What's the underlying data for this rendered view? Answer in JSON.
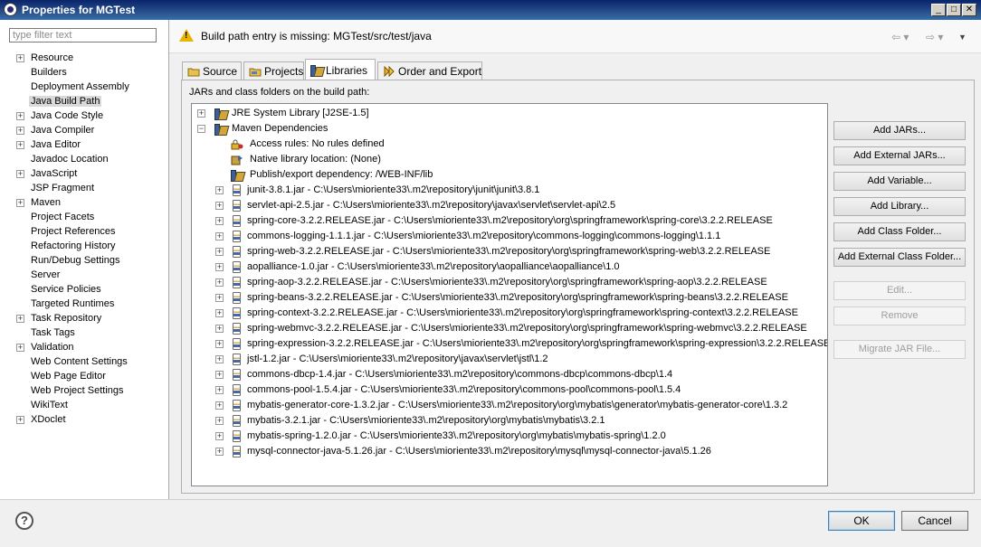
{
  "window": {
    "title": "Properties for MGTest"
  },
  "filter": {
    "placeholder": "type filter text"
  },
  "nav_tree": [
    {
      "label": "Resource",
      "expandable": true
    },
    {
      "label": "Builders",
      "expandable": false
    },
    {
      "label": "Deployment Assembly",
      "expandable": false
    },
    {
      "label": "Java Build Path",
      "expandable": false,
      "selected": true
    },
    {
      "label": "Java Code Style",
      "expandable": true
    },
    {
      "label": "Java Compiler",
      "expandable": true
    },
    {
      "label": "Java Editor",
      "expandable": true
    },
    {
      "label": "Javadoc Location",
      "expandable": false
    },
    {
      "label": "JavaScript",
      "expandable": true
    },
    {
      "label": "JSP Fragment",
      "expandable": false
    },
    {
      "label": "Maven",
      "expandable": true
    },
    {
      "label": "Project Facets",
      "expandable": false
    },
    {
      "label": "Project References",
      "expandable": false
    },
    {
      "label": "Refactoring History",
      "expandable": false
    },
    {
      "label": "Run/Debug Settings",
      "expandable": false
    },
    {
      "label": "Server",
      "expandable": false
    },
    {
      "label": "Service Policies",
      "expandable": false
    },
    {
      "label": "Targeted Runtimes",
      "expandable": false
    },
    {
      "label": "Task Repository",
      "expandable": true
    },
    {
      "label": "Task Tags",
      "expandable": false
    },
    {
      "label": "Validation",
      "expandable": true
    },
    {
      "label": "Web Content Settings",
      "expandable": false
    },
    {
      "label": "Web Page Editor",
      "expandable": false
    },
    {
      "label": "Web Project Settings",
      "expandable": false
    },
    {
      "label": "WikiText",
      "expandable": false
    },
    {
      "label": "XDoclet",
      "expandable": true
    }
  ],
  "message": {
    "text": "Build path entry is missing: MGTest/src/test/java"
  },
  "tabs": [
    {
      "label": "Source"
    },
    {
      "label": "Projects"
    },
    {
      "label": "Libraries",
      "active": true
    },
    {
      "label": "Order and Export"
    }
  ],
  "panel": {
    "label": "JARs and class folders on the build path:"
  },
  "libraries": {
    "jre": "JRE System Library [J2SE-1.5]",
    "maven": "Maven Dependencies",
    "maven_children": [
      "Access rules: No rules defined",
      "Native library location: (None)",
      "Publish/export dependency: /WEB-INF/lib"
    ],
    "jars": [
      "junit-3.8.1.jar - C:\\Users\\mioriente33\\.m2\\repository\\junit\\junit\\3.8.1",
      "servlet-api-2.5.jar - C:\\Users\\mioriente33\\.m2\\repository\\javax\\servlet\\servlet-api\\2.5",
      "spring-core-3.2.2.RELEASE.jar - C:\\Users\\mioriente33\\.m2\\repository\\org\\springframework\\spring-core\\3.2.2.RELEASE",
      "commons-logging-1.1.1.jar - C:\\Users\\mioriente33\\.m2\\repository\\commons-logging\\commons-logging\\1.1.1",
      "spring-web-3.2.2.RELEASE.jar - C:\\Users\\mioriente33\\.m2\\repository\\org\\springframework\\spring-web\\3.2.2.RELEASE",
      "aopalliance-1.0.jar - C:\\Users\\mioriente33\\.m2\\repository\\aopalliance\\aopalliance\\1.0",
      "spring-aop-3.2.2.RELEASE.jar - C:\\Users\\mioriente33\\.m2\\repository\\org\\springframework\\spring-aop\\3.2.2.RELEASE",
      "spring-beans-3.2.2.RELEASE.jar - C:\\Users\\mioriente33\\.m2\\repository\\org\\springframework\\spring-beans\\3.2.2.RELEASE",
      "spring-context-3.2.2.RELEASE.jar - C:\\Users\\mioriente33\\.m2\\repository\\org\\springframework\\spring-context\\3.2.2.RELEASE",
      "spring-webmvc-3.2.2.RELEASE.jar - C:\\Users\\mioriente33\\.m2\\repository\\org\\springframework\\spring-webmvc\\3.2.2.RELEASE",
      "spring-expression-3.2.2.RELEASE.jar - C:\\Users\\mioriente33\\.m2\\repository\\org\\springframework\\spring-expression\\3.2.2.RELEASE",
      "jstl-1.2.jar - C:\\Users\\mioriente33\\.m2\\repository\\javax\\servlet\\jstl\\1.2",
      "commons-dbcp-1.4.jar - C:\\Users\\mioriente33\\.m2\\repository\\commons-dbcp\\commons-dbcp\\1.4",
      "commons-pool-1.5.4.jar - C:\\Users\\mioriente33\\.m2\\repository\\commons-pool\\commons-pool\\1.5.4",
      "mybatis-generator-core-1.3.2.jar - C:\\Users\\mioriente33\\.m2\\repository\\org\\mybatis\\generator\\mybatis-generator-core\\1.3.2",
      "mybatis-3.2.1.jar - C:\\Users\\mioriente33\\.m2\\repository\\org\\mybatis\\mybatis\\3.2.1",
      "mybatis-spring-1.2.0.jar - C:\\Users\\mioriente33\\.m2\\repository\\org\\mybatis\\mybatis-spring\\1.2.0",
      "mysql-connector-java-5.1.26.jar - C:\\Users\\mioriente33\\.m2\\repository\\mysql\\mysql-connector-java\\5.1.26"
    ]
  },
  "buttons": {
    "add_jars": "Add JARs...",
    "add_external_jars": "Add External JARs...",
    "add_variable": "Add Variable...",
    "add_library": "Add Library...",
    "add_class_folder": "Add Class Folder...",
    "add_external_class_folder": "Add External Class Folder...",
    "edit": "Edit...",
    "remove": "Remove",
    "migrate_jar": "Migrate JAR File..."
  },
  "dialog": {
    "ok": "OK",
    "cancel": "Cancel"
  }
}
